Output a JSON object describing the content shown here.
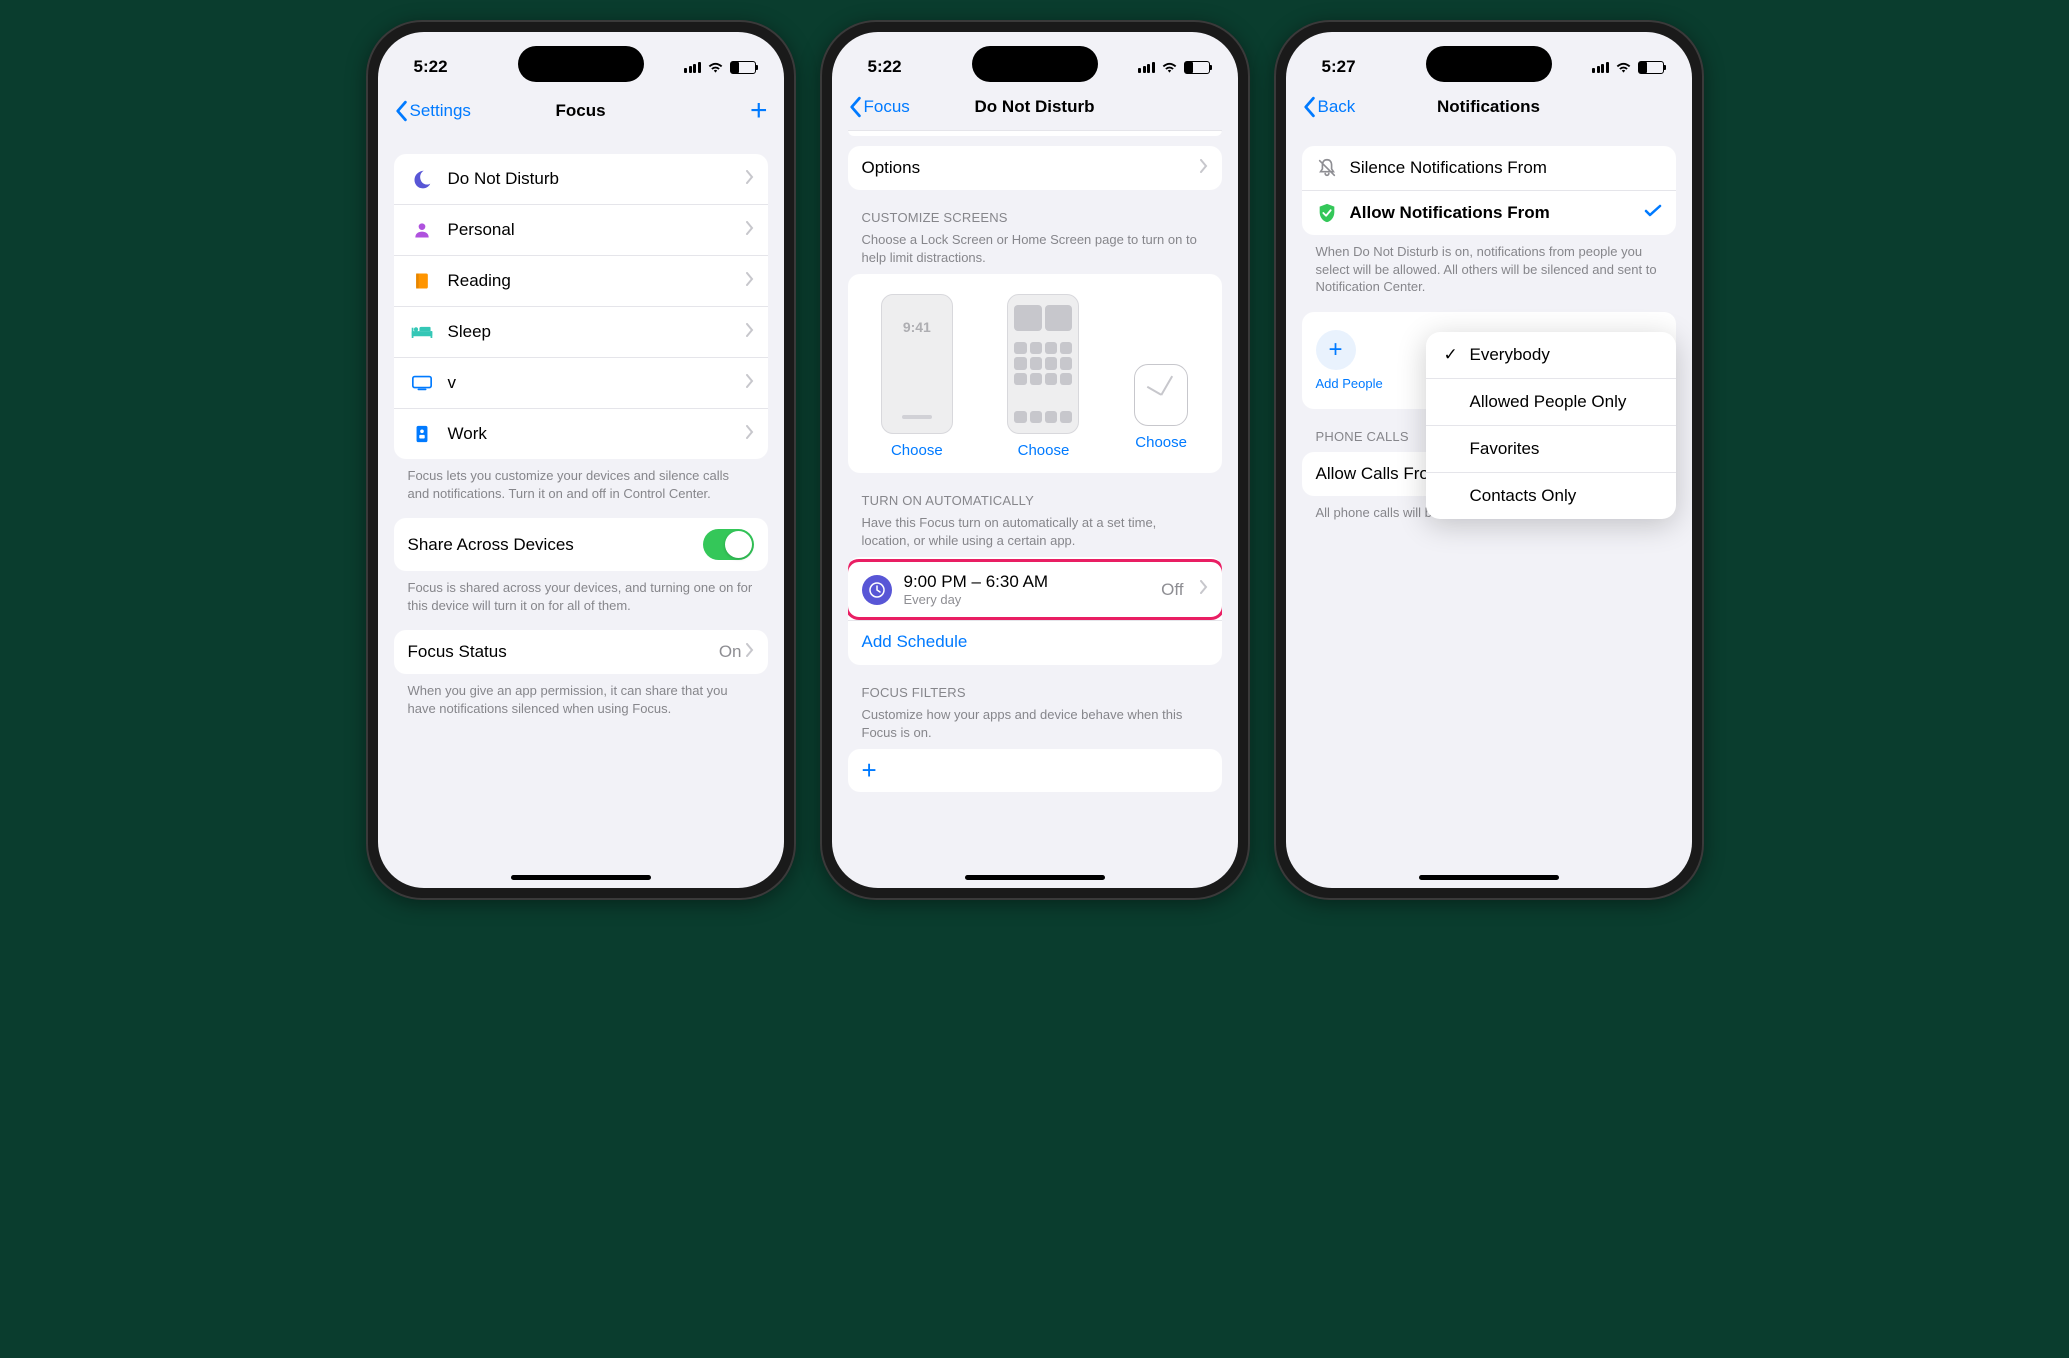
{
  "phone1": {
    "time": "5:22",
    "nav_back": "Settings",
    "nav_title": "Focus",
    "focus_list": [
      {
        "icon": "moon",
        "label": "Do Not Disturb"
      },
      {
        "icon": "person",
        "label": "Personal"
      },
      {
        "icon": "book",
        "label": "Reading"
      },
      {
        "icon": "bed",
        "label": "Sleep"
      },
      {
        "icon": "tv",
        "label": "v"
      },
      {
        "icon": "brief",
        "label": "Work"
      }
    ],
    "focus_footer": "Focus lets you customize your devices and silence calls and notifications. Turn it on and off in Control Center.",
    "share_label": "Share Across Devices",
    "share_footer": "Focus is shared across your devices, and turning one on for this device will turn it on for all of them.",
    "status_label": "Focus Status",
    "status_value": "On",
    "status_footer": "When you give an app permission, it can share that you have notifications silenced when using Focus."
  },
  "phone2": {
    "time": "5:22",
    "nav_back": "Focus",
    "nav_title": "Do Not Disturb",
    "options_label": "Options",
    "customize_header": "CUSTOMIZE SCREENS",
    "customize_desc": "Choose a Lock Screen or Home Screen page to turn on to help limit distractions.",
    "mock_time": "9:41",
    "choose": "Choose",
    "auto_header": "TURN ON AUTOMATICALLY",
    "auto_desc": "Have this Focus turn on automatically at a set time, location, or while using a certain app.",
    "sched_title": "9:00 PM – 6:30 AM",
    "sched_sub": "Every day",
    "sched_value": "Off",
    "add_schedule": "Add Schedule",
    "filters_header": "FOCUS FILTERS",
    "filters_desc": "Customize how your apps and device behave when this Focus is on."
  },
  "phone3": {
    "time": "5:27",
    "nav_back": "Back",
    "nav_title": "Notifications",
    "silence_label": "Silence Notifications From",
    "allow_label": "Allow Notifications From",
    "allow_footer": "When Do Not Disturb is on, notifications from people you select will be allowed. All others will be silenced and sent to Notification Center.",
    "add_people": "Add People",
    "calls_header": "PHONE CALLS",
    "calls_label": "Allow Calls From",
    "calls_value": "Everybody",
    "calls_footer": "All phone calls will be allowed.",
    "popup": [
      "Everybody",
      "Allowed People Only",
      "Favorites",
      "Contacts Only"
    ]
  }
}
